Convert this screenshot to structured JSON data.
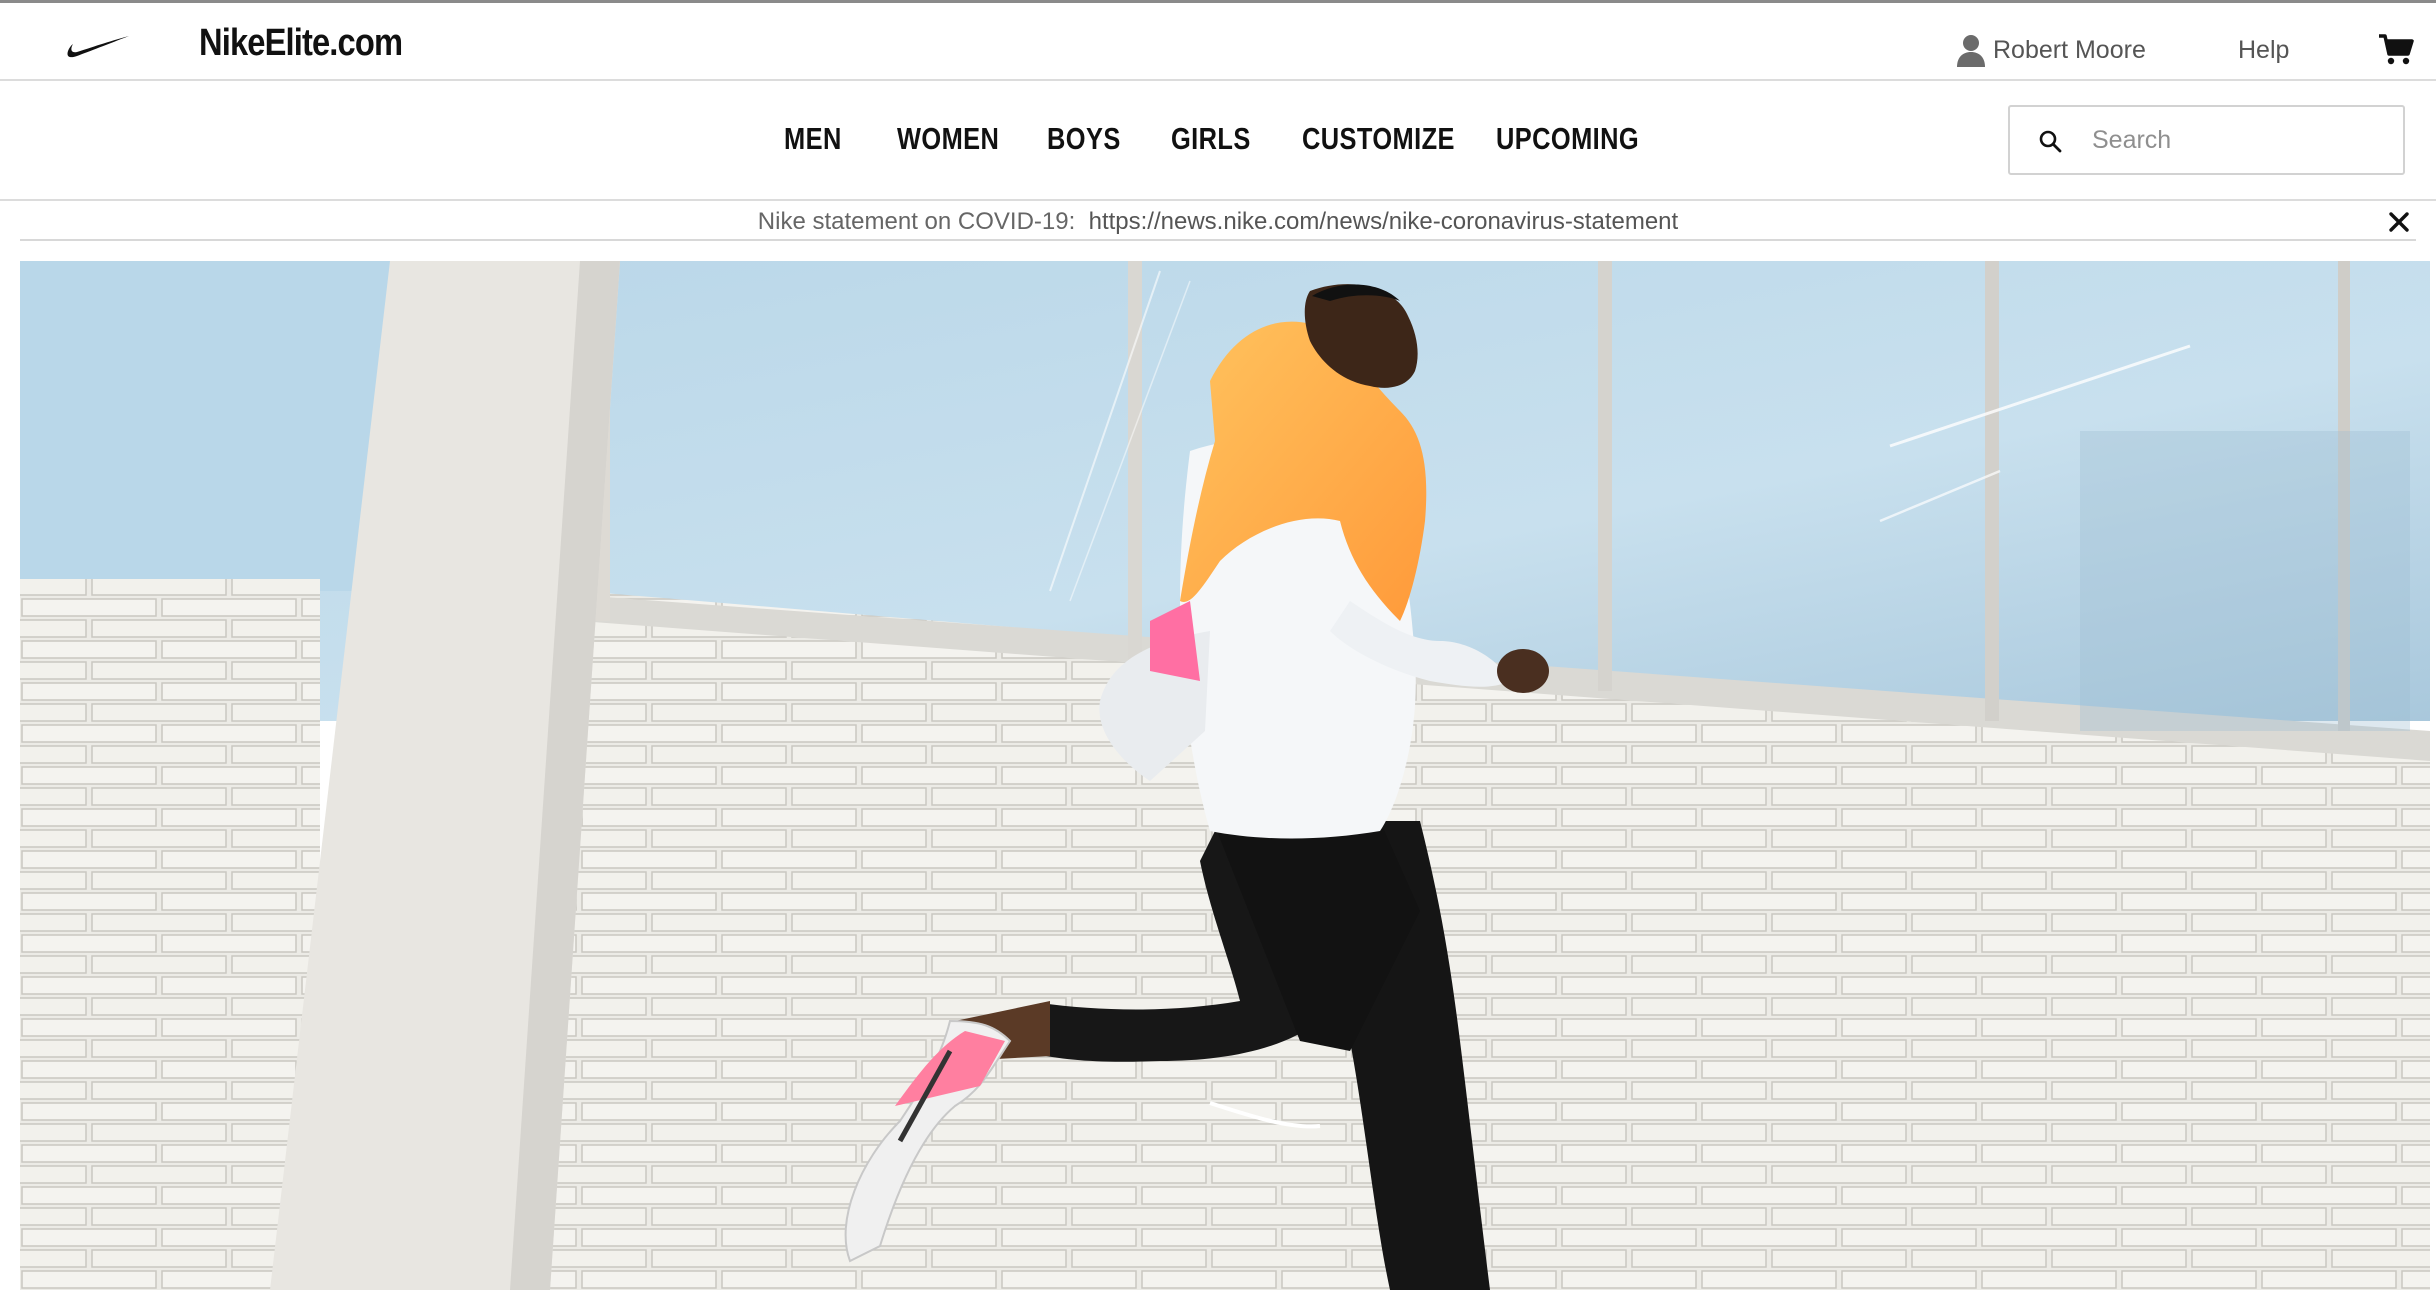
{
  "header": {
    "logo_icon": "nike-swoosh-icon",
    "site_title": "NikeElite.com",
    "user_name": "Robert Moore",
    "user_icon": "user-icon",
    "help_label": "Help",
    "cart_icon": "cart-icon"
  },
  "nav": {
    "items": [
      {
        "label": "MEN"
      },
      {
        "label": "WOMEN"
      },
      {
        "label": "BOYS"
      },
      {
        "label": "GIRLS"
      },
      {
        "label": "CUSTOMIZE"
      },
      {
        "label": "UPCOMING"
      }
    ],
    "search": {
      "icon": "search-icon",
      "placeholder": "Search",
      "value": ""
    }
  },
  "notice": {
    "text": "Nike statement on COVID-19:",
    "link": "https://news.nike.com/news/nike-coronavirus-statement",
    "close_icon": "close-icon"
  },
  "hero": {
    "image": "runner-in-white-jacket-against-brick-wall",
    "colors": {
      "sky": "#bcd9ea",
      "brick": "#ebe9e3",
      "jacket": "#f4f6f8",
      "hood": "#ffb24a",
      "pants": "#141414"
    }
  }
}
